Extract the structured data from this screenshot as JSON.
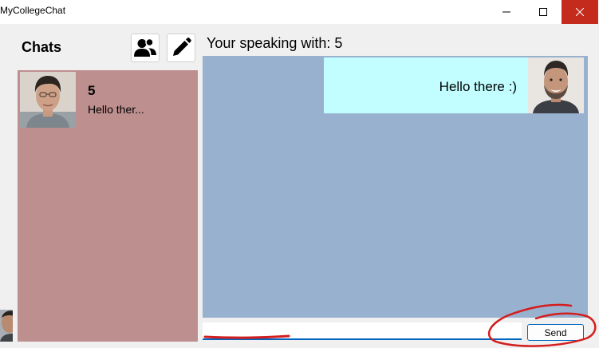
{
  "window": {
    "title": "MyCollegeChat",
    "minimize_icon": "minimize-icon",
    "maximize_icon": "maximize-icon",
    "close_icon": "close-icon",
    "close_color": "#c42b1c"
  },
  "sidebar": {
    "heading": "Chats",
    "contacts_icon": "contacts-icon",
    "compose_icon": "pencil-icon",
    "background_color": "#bd8f8e",
    "chats": [
      {
        "name": "5",
        "preview": "Hello ther...",
        "avatar": "avatar-man-dark-hair"
      }
    ]
  },
  "conversation": {
    "header": "Your speaking with: 5",
    "background_color": "#97b1cf",
    "messages": [
      {
        "text": "Hello there :)",
        "avatar": "avatar-man-beard",
        "bubble_color": "#c2feff"
      }
    ]
  },
  "composer": {
    "input_value": "",
    "send_label": "Send"
  },
  "annotations": {
    "underline_color": "#d41e1e",
    "circle_color": "#d41e1e"
  }
}
